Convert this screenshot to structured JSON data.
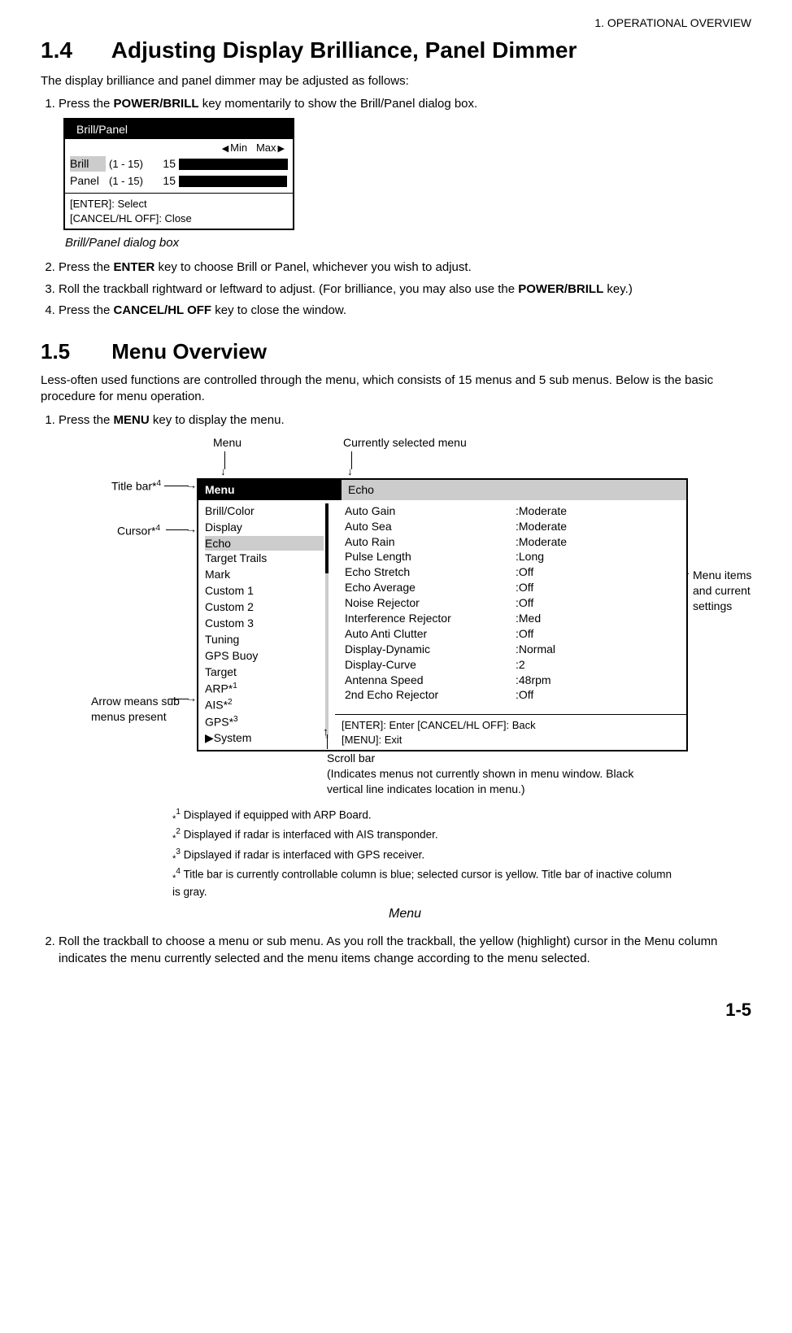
{
  "header": {
    "chapter": "1. OPERATIONAL OVERVIEW"
  },
  "section14": {
    "num": "1.4",
    "title": "Adjusting Display Brilliance, Panel Dimmer",
    "intro": "The display brilliance and panel dimmer may be adjusted as follows:",
    "step1_pre": "Press the ",
    "step1_key": "POWER/BRILL",
    "step1_post": " key momentarily to show the Brill/Panel dialog box.",
    "dialog": {
      "title": "Brill/Panel",
      "min": "Min",
      "max": "Max",
      "brill_label": "Brill",
      "brill_range": "(1 - 15)",
      "brill_value": "15",
      "panel_label": "Panel",
      "panel_range": "(1 - 15)",
      "panel_value": "15",
      "footer_enter": "[ENTER]: Select",
      "footer_cancel": "[CANCEL/HL OFF]: Close"
    },
    "caption": "Brill/Panel dialog box",
    "step2_pre": "Press the ",
    "step2_key": "ENTER",
    "step2_post": " key to choose Brill or Panel, whichever you wish to adjust.",
    "step3_pre": "Roll the trackball rightward or leftward to adjust. (For brilliance, you may also use the ",
    "step3_key": "POWER/BRILL",
    "step3_post": " key.)",
    "step4_pre": "Press the ",
    "step4_key": "CANCEL/HL OFF",
    "step4_post": " key to close the window."
  },
  "section15": {
    "num": "1.5",
    "title": "Menu Overview",
    "intro": "Less-often used functions are controlled through the menu, which consists of 15 menus and 5 sub menus. Below is the basic procedure for menu operation.",
    "step1_pre": "Press the ",
    "step1_key": "MENU",
    "step1_post": " key to display the menu.",
    "labels": {
      "menu_top": "Menu",
      "current_menu": "Currently selected menu",
      "title_bar": "Title bar*",
      "title_bar_sup": "4",
      "cursor": "Cursor*",
      "cursor_sup": "4",
      "arrow_sub": "Arrow means sub menus present",
      "scroll_bar_title": "Scroll bar",
      "scroll_bar_desc": "(Indicates menus not currently shown in menu window. Black vertical line indicates location in menu.)",
      "menu_items_side": "Menu items and current settings"
    },
    "menu_box": {
      "left_title": "Menu",
      "right_title": "Echo",
      "left_items": [
        "Brill/Color",
        "Display",
        "Echo",
        "Target Trails",
        "Mark",
        "Custom 1",
        "Custom 2",
        "Custom 3",
        "Tuning",
        "GPS Buoy",
        "Target",
        "ARP*1",
        "AIS*2",
        "GPS*3",
        "▶System"
      ],
      "left_selected_index": 2,
      "right_items": [
        {
          "name": "Auto Gain",
          "val": ":Moderate"
        },
        {
          "name": "Auto Sea",
          "val": ":Moderate"
        },
        {
          "name": "Auto Rain",
          "val": ":Moderate"
        },
        {
          "name": "Pulse Length",
          "val": ":Long"
        },
        {
          "name": "Echo Stretch",
          "val": ":Off"
        },
        {
          "name": "Echo Average",
          "val": ":Off"
        },
        {
          "name": "Noise Rejector",
          "val": ":Off"
        },
        {
          "name": "Interference Rejector",
          "val": ":Med"
        },
        {
          "name": "Auto Anti Clutter",
          "val": ":Off"
        },
        {
          "name": "Display-Dynamic",
          "val": ":Normal"
        },
        {
          "name": "Display-Curve",
          "val": ":2"
        },
        {
          "name": "Antenna Speed",
          "val": ":48rpm"
        },
        {
          "name": "2nd Echo Rejector",
          "val": ":Off"
        }
      ],
      "footer_l1": "[ENTER]: Enter  [CANCEL/HL OFF]: Back",
      "footer_l2": "[MENU]: Exit"
    },
    "footnotes": {
      "f1": "Displayed if equipped with ARP Board.",
      "f2": "Displayed if radar is interfaced with AIS transponder.",
      "f3": "Dipslayed if radar is interfaced with GPS receiver.",
      "f4": "Title bar is currently controllable column is blue; selected cursor is yellow. Title bar of inactive column is gray."
    },
    "figure_caption": "Menu",
    "step2": "Roll the trackball to choose a menu or sub menu. As you roll the trackball, the yellow (highlight) cursor in the Menu column indicates the menu currently selected and the menu items change according to the menu selected."
  },
  "page_number": "1-5"
}
